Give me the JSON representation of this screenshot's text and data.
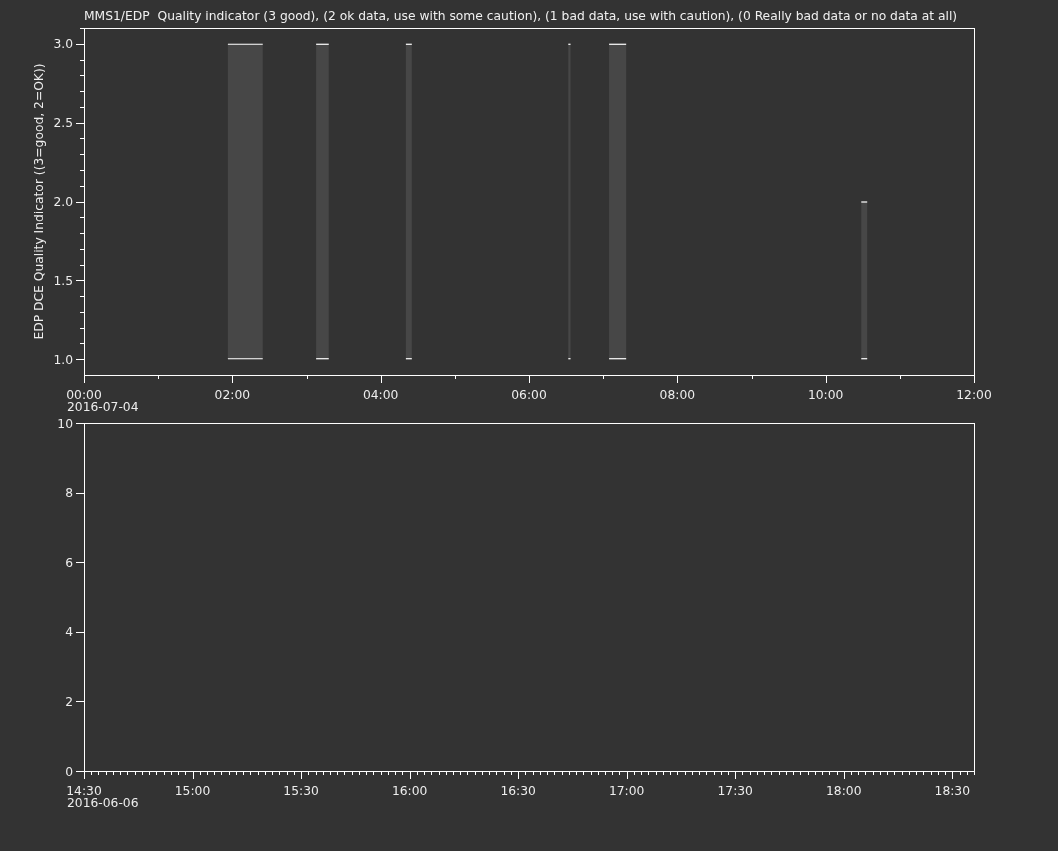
{
  "plots": [
    {
      "title": "MMS1/EDP  Quality indicator (3 good), (2 ok data, use with some caution), (1 bad data, use with caution), (0 Really bad data or no data at all)",
      "date": "2016-07-04",
      "chart_data": {
        "type": "area",
        "ylabel": "EDP DCE Quality Indicator ((3=good, 2=OK))",
        "x": [
          1.94,
          2.41,
          3.13,
          3.3,
          4.34,
          4.42,
          6.53,
          6.56,
          7.08,
          7.31,
          10.48,
          10.56
        ],
        "series": [
          {
            "color": "#474747",
            "values": [
              3,
              3,
              null,
              null,
              null,
              null,
              null,
              null,
              null,
              null,
              null,
              null
            ]
          },
          {
            "color": "#474747",
            "values": [
              null,
              null,
              3,
              3,
              null,
              null,
              null,
              null,
              null,
              null,
              null,
              null
            ]
          },
          {
            "color": "#474747",
            "values": [
              null,
              null,
              null,
              null,
              3,
              3,
              null,
              null,
              null,
              null,
              null,
              null
            ]
          },
          {
            "color": "#474747",
            "values": [
              null,
              null,
              null,
              null,
              null,
              null,
              3,
              3,
              null,
              null,
              null,
              null
            ]
          },
          {
            "color": "#474747",
            "values": [
              null,
              null,
              null,
              null,
              null,
              null,
              null,
              null,
              3,
              3,
              null,
              null
            ]
          },
          {
            "color": "#474747",
            "values": [
              null,
              null,
              null,
              null,
              null,
              null,
              null,
              null,
              null,
              null,
              2,
              2
            ]
          }
        ],
        "xlim": [
          0,
          12
        ],
        "ylim": [
          0.9,
          3.1
        ],
        "xticks": [
          {
            "value": 0,
            "label": "00:00"
          },
          {
            "value": 2,
            "label": "02:00"
          },
          {
            "value": 4,
            "label": "04:00"
          },
          {
            "value": 6,
            "label": "06:00"
          },
          {
            "value": 8,
            "label": "08:00"
          },
          {
            "value": 10,
            "label": "10:00"
          },
          {
            "value": 12,
            "label": "12:00"
          }
        ],
        "yticks": [
          {
            "value": 1,
            "label": "1.0"
          },
          {
            "value": 1.5,
            "label": "1.5"
          },
          {
            "value": 2,
            "label": "2.0"
          },
          {
            "value": 2.5,
            "label": "2.5"
          },
          {
            "value": 3,
            "label": "3.0"
          }
        ]
      }
    },
    {
      "date": "2016-06-06",
      "chart_data": {
        "type": "line",
        "xlim": [
          14.5,
          18.6
        ],
        "ylim": [
          0,
          10
        ],
        "xticks": [
          {
            "value": 14.5,
            "label": "14:30"
          },
          {
            "value": 15,
            "label": "15:00"
          },
          {
            "value": 15.5,
            "label": "15:30"
          },
          {
            "value": 16,
            "label": "16:00"
          },
          {
            "value": 16.5,
            "label": "16:30"
          },
          {
            "value": 17,
            "label": "17:00"
          },
          {
            "value": 17.5,
            "label": "17:30"
          },
          {
            "value": 18,
            "label": "18:00"
          },
          {
            "value": 18.5,
            "label": "18:30"
          }
        ],
        "yticks": [
          0,
          2,
          4,
          6,
          8,
          10
        ]
      }
    }
  ]
}
